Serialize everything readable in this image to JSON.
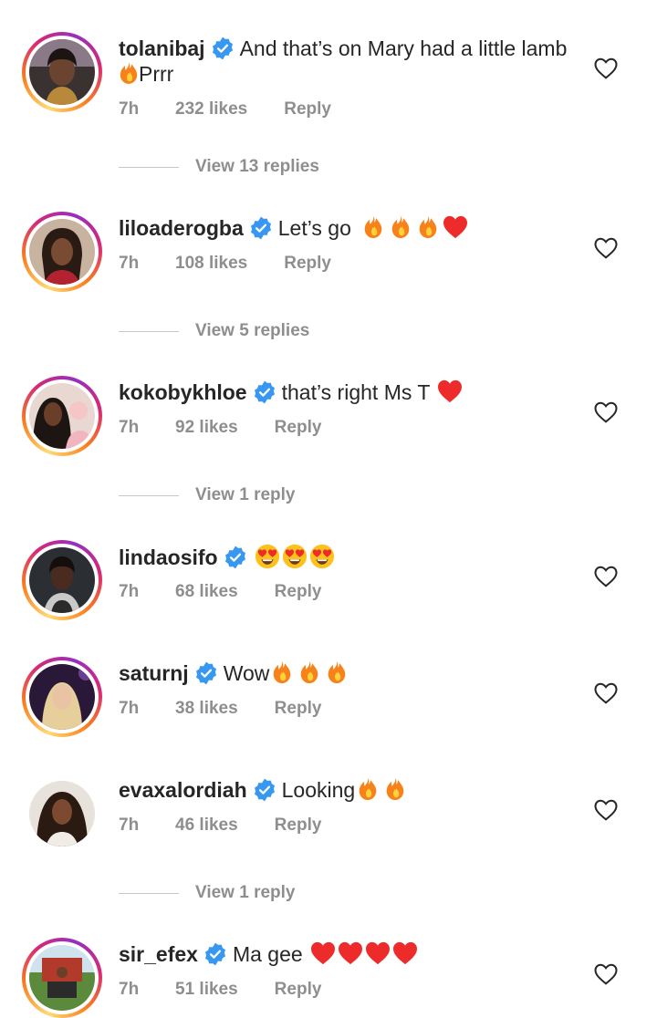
{
  "colors": {
    "verified": "#3897f0",
    "meta": "#8e8e8e",
    "heart_red": "#ed2b2b",
    "fire": "#f7821b"
  },
  "comments": [
    {
      "username": "tolanibaj",
      "text": "And that’s on Mary had a little lamb",
      "text_after": "Prrr",
      "time": "7h",
      "likes": "232 likes",
      "reply": "Reply",
      "view_replies": "View 13 replies"
    },
    {
      "username": "liloaderogba",
      "text": "Let’s go",
      "time": "7h",
      "likes": "108 likes",
      "reply": "Reply",
      "view_replies": "View 5 replies"
    },
    {
      "username": "kokobykhloe",
      "text": "that’s right Ms T",
      "time": "7h",
      "likes": "92 likes",
      "reply": "Reply",
      "view_replies": "View 1 reply"
    },
    {
      "username": "lindaosifo",
      "text": "",
      "time": "7h",
      "likes": "68 likes",
      "reply": "Reply"
    },
    {
      "username": "saturnj",
      "text": "Wow",
      "time": "7h",
      "likes": "38 likes",
      "reply": "Reply"
    },
    {
      "username": "evaxalordiah",
      "text": "Looking",
      "time": "7h",
      "likes": "46 likes",
      "reply": "Reply",
      "view_replies": "View 1 reply"
    },
    {
      "username": "sir_efex",
      "text": "Ma gee",
      "time": "7h",
      "likes": "51 likes",
      "reply": "Reply"
    }
  ]
}
